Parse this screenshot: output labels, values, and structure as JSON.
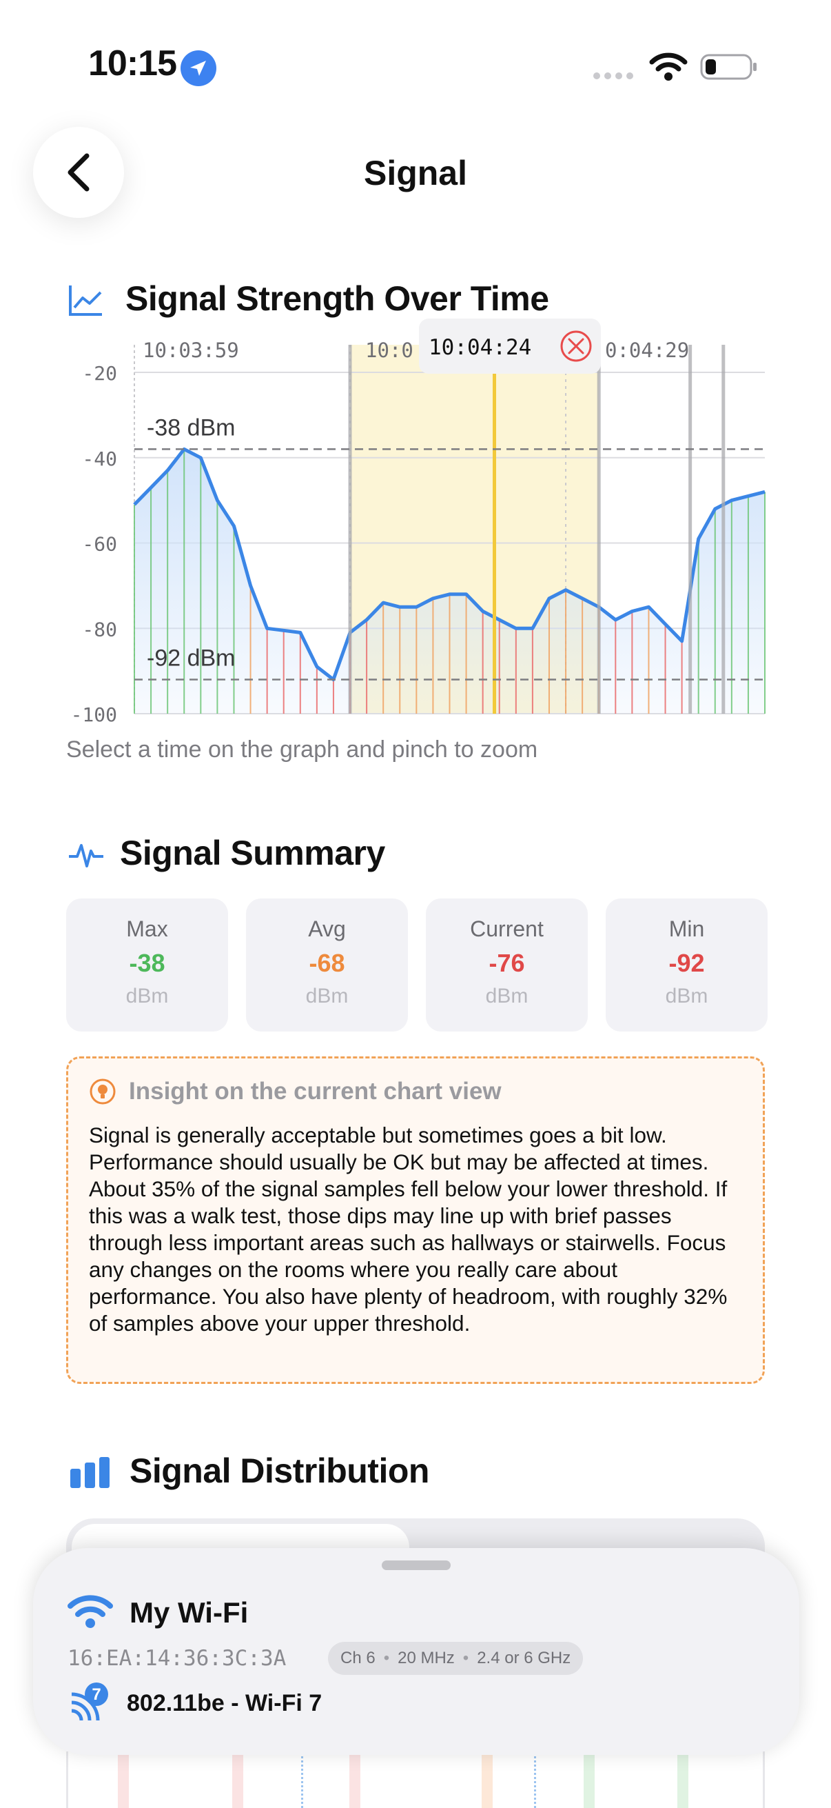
{
  "status_bar": {
    "time": "10:15"
  },
  "nav": {
    "title": "Signal"
  },
  "signal_chart": {
    "title": "Signal Strength Over Time",
    "hint": "Select a time on the graph and pinch to zoom",
    "selected_time": "10:04:24",
    "colors": {
      "line": "#3b86e6",
      "selection": "#fcf5d6",
      "cursor": "#f2c93a",
      "good": "#6cc576",
      "ok": "#f0a262",
      "bad": "#ea6b6b"
    },
    "chart_data": {
      "type": "line",
      "x_tick_labels": [
        "10:03:59",
        "10:0",
        "0:04:29"
      ],
      "y_tick_labels": [
        "-20",
        "-40",
        "-60",
        "-80",
        "-100"
      ],
      "ylim": [
        -100,
        -20
      ],
      "thresholds": [
        {
          "label": "-38 dBm",
          "value": -38
        },
        {
          "label": "-92 dBm",
          "value": -92
        }
      ],
      "values": [
        -51,
        -47,
        -43,
        -38,
        -40,
        -50,
        -56,
        -70,
        -80,
        -80.5,
        -81,
        -89,
        -92,
        -81,
        -78,
        -74,
        -75,
        -75,
        -73,
        -72,
        -72,
        -76,
        -78,
        -80,
        -80,
        -73,
        -71,
        -73,
        -75,
        -78,
        -76,
        -75,
        -79,
        -83,
        -59,
        -52,
        -50,
        -49,
        -48
      ]
    }
  },
  "summary": {
    "title": "Signal Summary",
    "cards": [
      {
        "label": "Max",
        "value": "-38",
        "unit": "dBm",
        "color": "#4db85a"
      },
      {
        "label": "Avg",
        "value": "-68",
        "unit": "dBm",
        "color": "#ee8a3c"
      },
      {
        "label": "Current",
        "value": "-76",
        "unit": "dBm",
        "color": "#e04848"
      },
      {
        "label": "Min",
        "value": "-92",
        "unit": "dBm",
        "color": "#e04848"
      }
    ]
  },
  "insight": {
    "title": "Insight on the current chart view",
    "body": "Signal is generally acceptable but sometimes goes a bit low. Performance should usually be OK but may be affected at times. About 35% of the signal samples fell below your lower threshold. If this was a walk test, those dips may line up with brief passes through less important areas such as hallways or stairwells. Focus any changes on the rooms where you really care about performance. You also have plenty of headroom, with roughly 32% of samples above your upper threshold."
  },
  "distribution": {
    "title": "Signal Distribution"
  },
  "network_sheet": {
    "name": "My Wi-Fi",
    "bssid": "16:EA:14:36:3C:3A",
    "channel": "Ch 6",
    "width": "20 MHz",
    "band": "2.4 or 6 GHz",
    "standard": "802.11be - Wi-Fi 7",
    "standard_badge": "7"
  }
}
